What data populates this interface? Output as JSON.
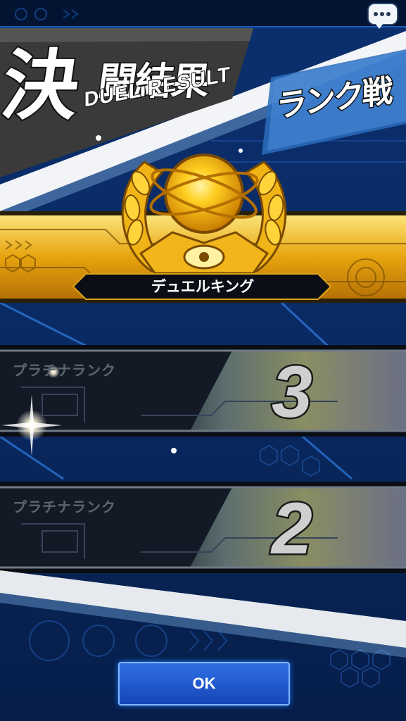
{
  "title": {
    "jp_big": "決",
    "jp_small": "闘結果",
    "en": "DUEL RESULT"
  },
  "mode_label": "ランク戦",
  "rank_badge": {
    "name": "デュエルキング",
    "color": "#f5c419"
  },
  "rank_rows": [
    {
      "label": "プラチナランク",
      "number": "3"
    },
    {
      "label": "プラチナランク",
      "number": "2"
    }
  ],
  "ok_button": {
    "label": "OK"
  },
  "colors": {
    "background": "#07255a",
    "accent_blue": "#1e6cff",
    "gold": "#f5c419"
  },
  "icons": [
    "chat-icon",
    "trophy-medal-icon",
    "sparkle-icon"
  ]
}
